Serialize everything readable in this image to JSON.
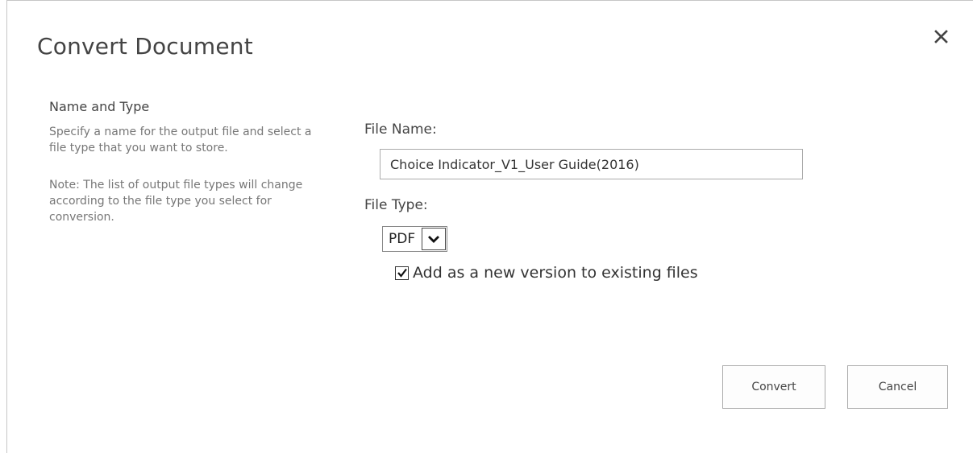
{
  "dialog": {
    "title": "Convert Document",
    "close_icon": "close-icon"
  },
  "section": {
    "heading": "Name and Type",
    "description": "Specify a name for the output file and select a file type that you want to store.",
    "note": "Note: The list of output file types will change according to the file type you select for conversion."
  },
  "file_name": {
    "label": "File Name:",
    "value": "Choice Indicator_V1_User Guide(2016)"
  },
  "file_type": {
    "label": "File Type:",
    "selected": "PDF",
    "arrow_icon": "chevron-down-icon"
  },
  "add_version": {
    "label": "Add as a new version to existing files",
    "checked": true
  },
  "buttons": {
    "convert": "Convert",
    "cancel": "Cancel"
  }
}
